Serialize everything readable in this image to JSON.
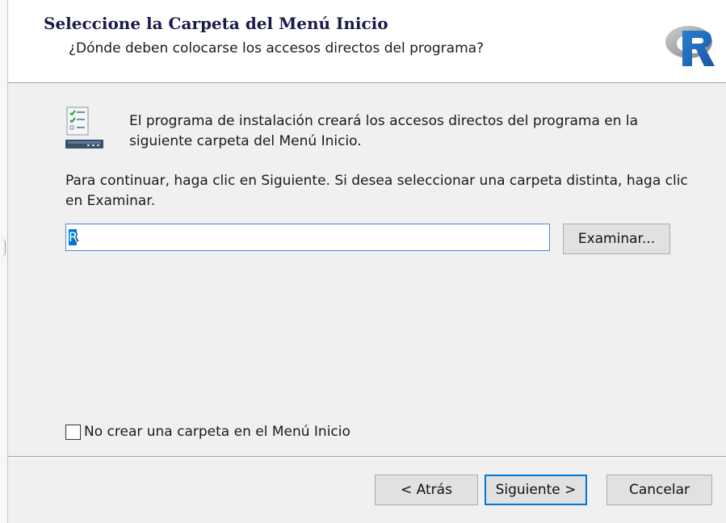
{
  "header": {
    "title": "Seleccione la Carpeta del Menú Inicio",
    "subtitle": "¿Dónde deben colocarse los accesos directos del programa?",
    "logo_icon": "r-logo-icon"
  },
  "content": {
    "intro": "El programa de instalación creará los accesos directos del programa en la siguiente carpeta del Menú Inicio.",
    "instructions": "Para continuar, haga clic en Siguiente. Si desea seleccionar una carpeta distinta, haga clic en Examinar.",
    "folder_value": "R",
    "browse_label": "Examinar...",
    "no_folder_label": "No crear una carpeta en el Menú Inicio",
    "no_folder_checked": false
  },
  "footer": {
    "back_label": "< Atrás",
    "next_label": "Siguiente >",
    "cancel_label": "Cancelar"
  },
  "colors": {
    "accent": "#0078d7",
    "header_bg": "#ffffff",
    "body_bg": "#f0f0f0",
    "title": "#1a1a4a"
  }
}
